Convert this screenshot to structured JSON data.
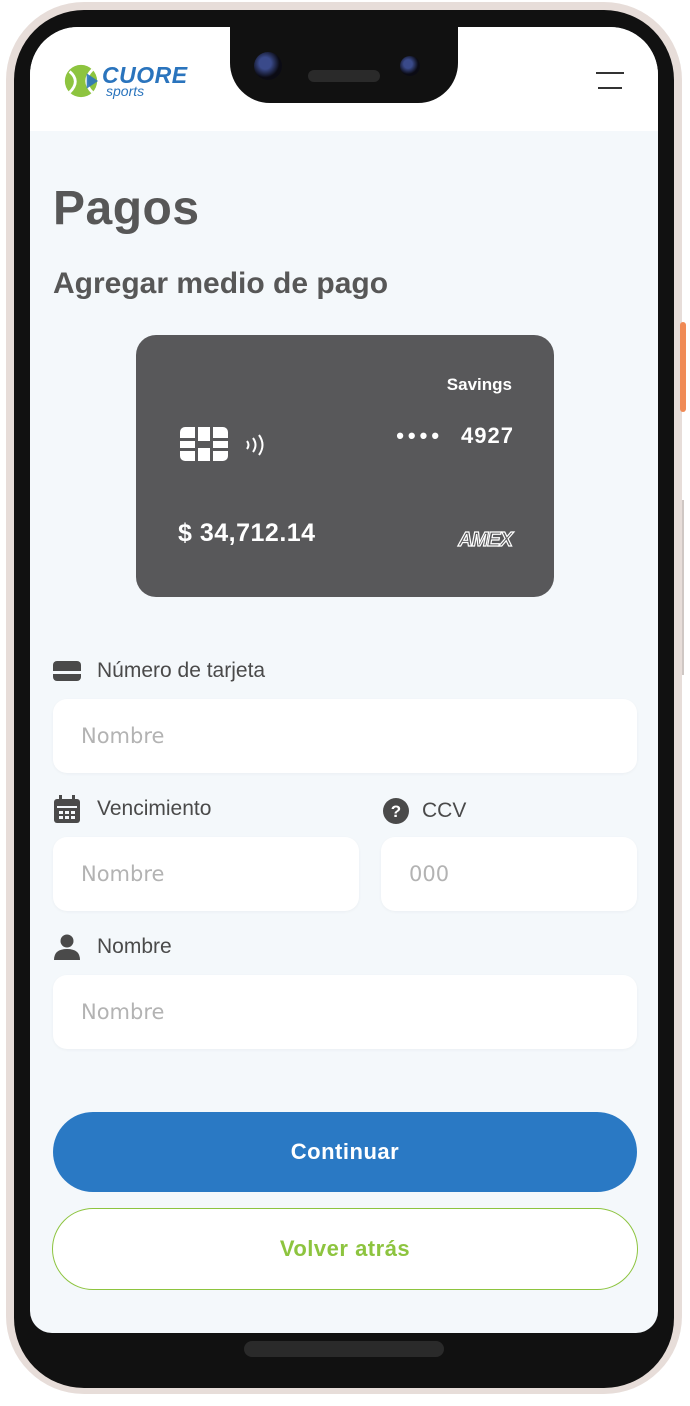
{
  "header": {
    "brand": "CUORE",
    "brand_sub": "sports"
  },
  "page": {
    "title": "Pagos",
    "subtitle": "Agregar medio de pago"
  },
  "card": {
    "account_type": "Savings",
    "masked_dots": "••••",
    "last_digits": "4927",
    "balance": "$ 34,712.14",
    "brand": "AMEX"
  },
  "form": {
    "card_number": {
      "label": "Número de tarjeta",
      "placeholder": "Nombre",
      "value": ""
    },
    "expiry": {
      "label": "Vencimiento",
      "placeholder": "Nombre",
      "value": ""
    },
    "ccv": {
      "label": "CCV",
      "placeholder": "000",
      "value": ""
    },
    "name": {
      "label": "Nombre",
      "placeholder": "Nombre",
      "value": ""
    }
  },
  "actions": {
    "continue": "Continuar",
    "back": "Volver atrás"
  },
  "colors": {
    "primary": "#2a79c4",
    "accent_green": "#8dc43f",
    "card_bg": "#58585a",
    "background": "#f4f8fb",
    "text": "#575757"
  },
  "icons": [
    "menu-icon",
    "card-icon",
    "calendar-icon",
    "help-icon",
    "user-icon",
    "chip-icon",
    "contactless-icon"
  ]
}
